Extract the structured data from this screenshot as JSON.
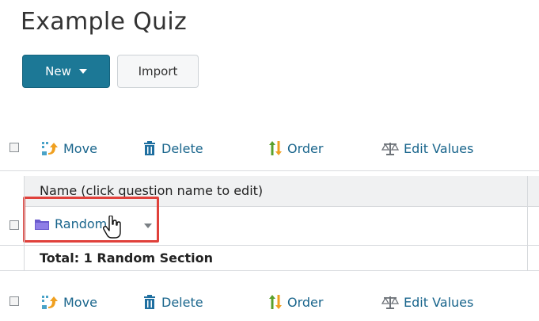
{
  "page": {
    "title": "Example Quiz"
  },
  "buttons": {
    "new_label": "New",
    "import_label": "Import"
  },
  "toolbar": {
    "move": "Move",
    "delete": "Delete",
    "order": "Order",
    "edit_values": "Edit Values"
  },
  "grid": {
    "header": "Name (click question name to edit)",
    "rows": [
      {
        "label": "Random",
        "icon": "folder-icon"
      }
    ],
    "total": "Total: 1 Random Section"
  },
  "colors": {
    "primary_button": "#1c7896",
    "link": "#19658c",
    "highlight": "#e0413b"
  }
}
